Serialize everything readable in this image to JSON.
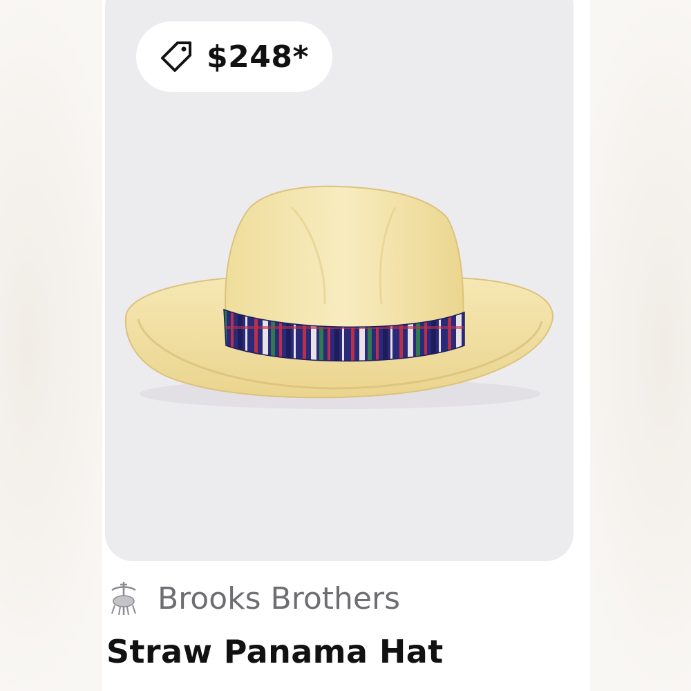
{
  "product": {
    "price": "$248*",
    "brand": "Brooks Brothers",
    "title": "Straw Panama Hat",
    "image_subject": "straw-panama-hat"
  },
  "icons": {
    "price_tag": "tag-icon",
    "brand_logo": "golden-fleece-logo"
  },
  "colors": {
    "image_background": "#ecebee",
    "hat_straw": "#f3e4a8",
    "hat_band_navy": "#2a2a7a",
    "hat_band_red": "#b8304a",
    "hat_band_green": "#2f7a4e",
    "brand_text": "#6e6e72",
    "title_text": "#111111"
  }
}
